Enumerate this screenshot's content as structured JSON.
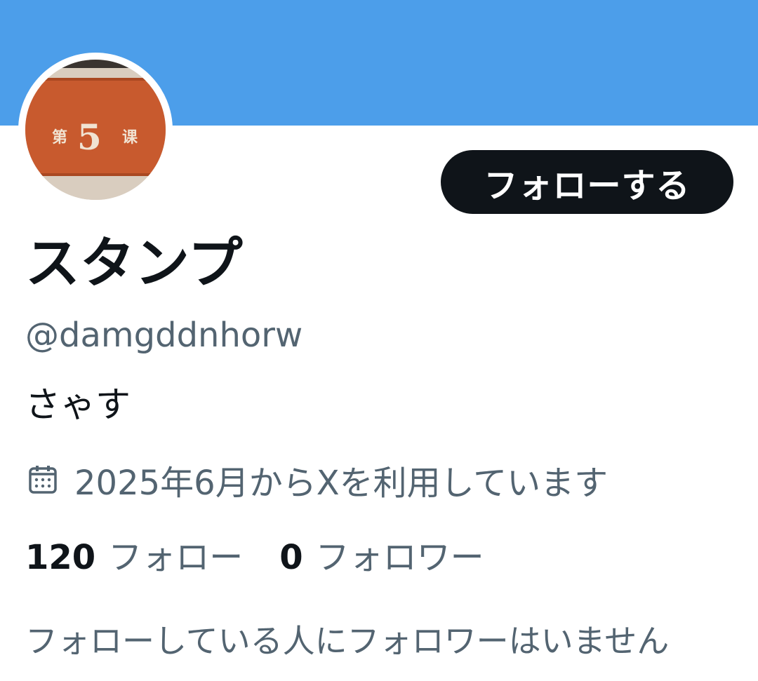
{
  "profile": {
    "banner_color": "#4c9eea",
    "avatar": {
      "description_icon": "avatar-lesson-badge",
      "text_left": "第",
      "text_number": "5",
      "text_right": "课",
      "badge_color": "#c85a2e"
    },
    "follow_button_label": "フォローする",
    "display_name": "スタンプ",
    "handle": "@damgddnhorw",
    "bio": "さゃす",
    "joined": {
      "icon": "calendar-icon",
      "text": "2025年6月からXを利用しています"
    },
    "stats": {
      "following_count": "120",
      "following_label": "フォロー",
      "followers_count": "0",
      "followers_label": "フォロワー"
    },
    "mutual_note": "フォローしている人にフォロワーはいません"
  },
  "colors": {
    "text_primary": "#0f1419",
    "text_secondary": "#536471",
    "button_bg": "#0f1419",
    "button_text": "#ffffff"
  }
}
